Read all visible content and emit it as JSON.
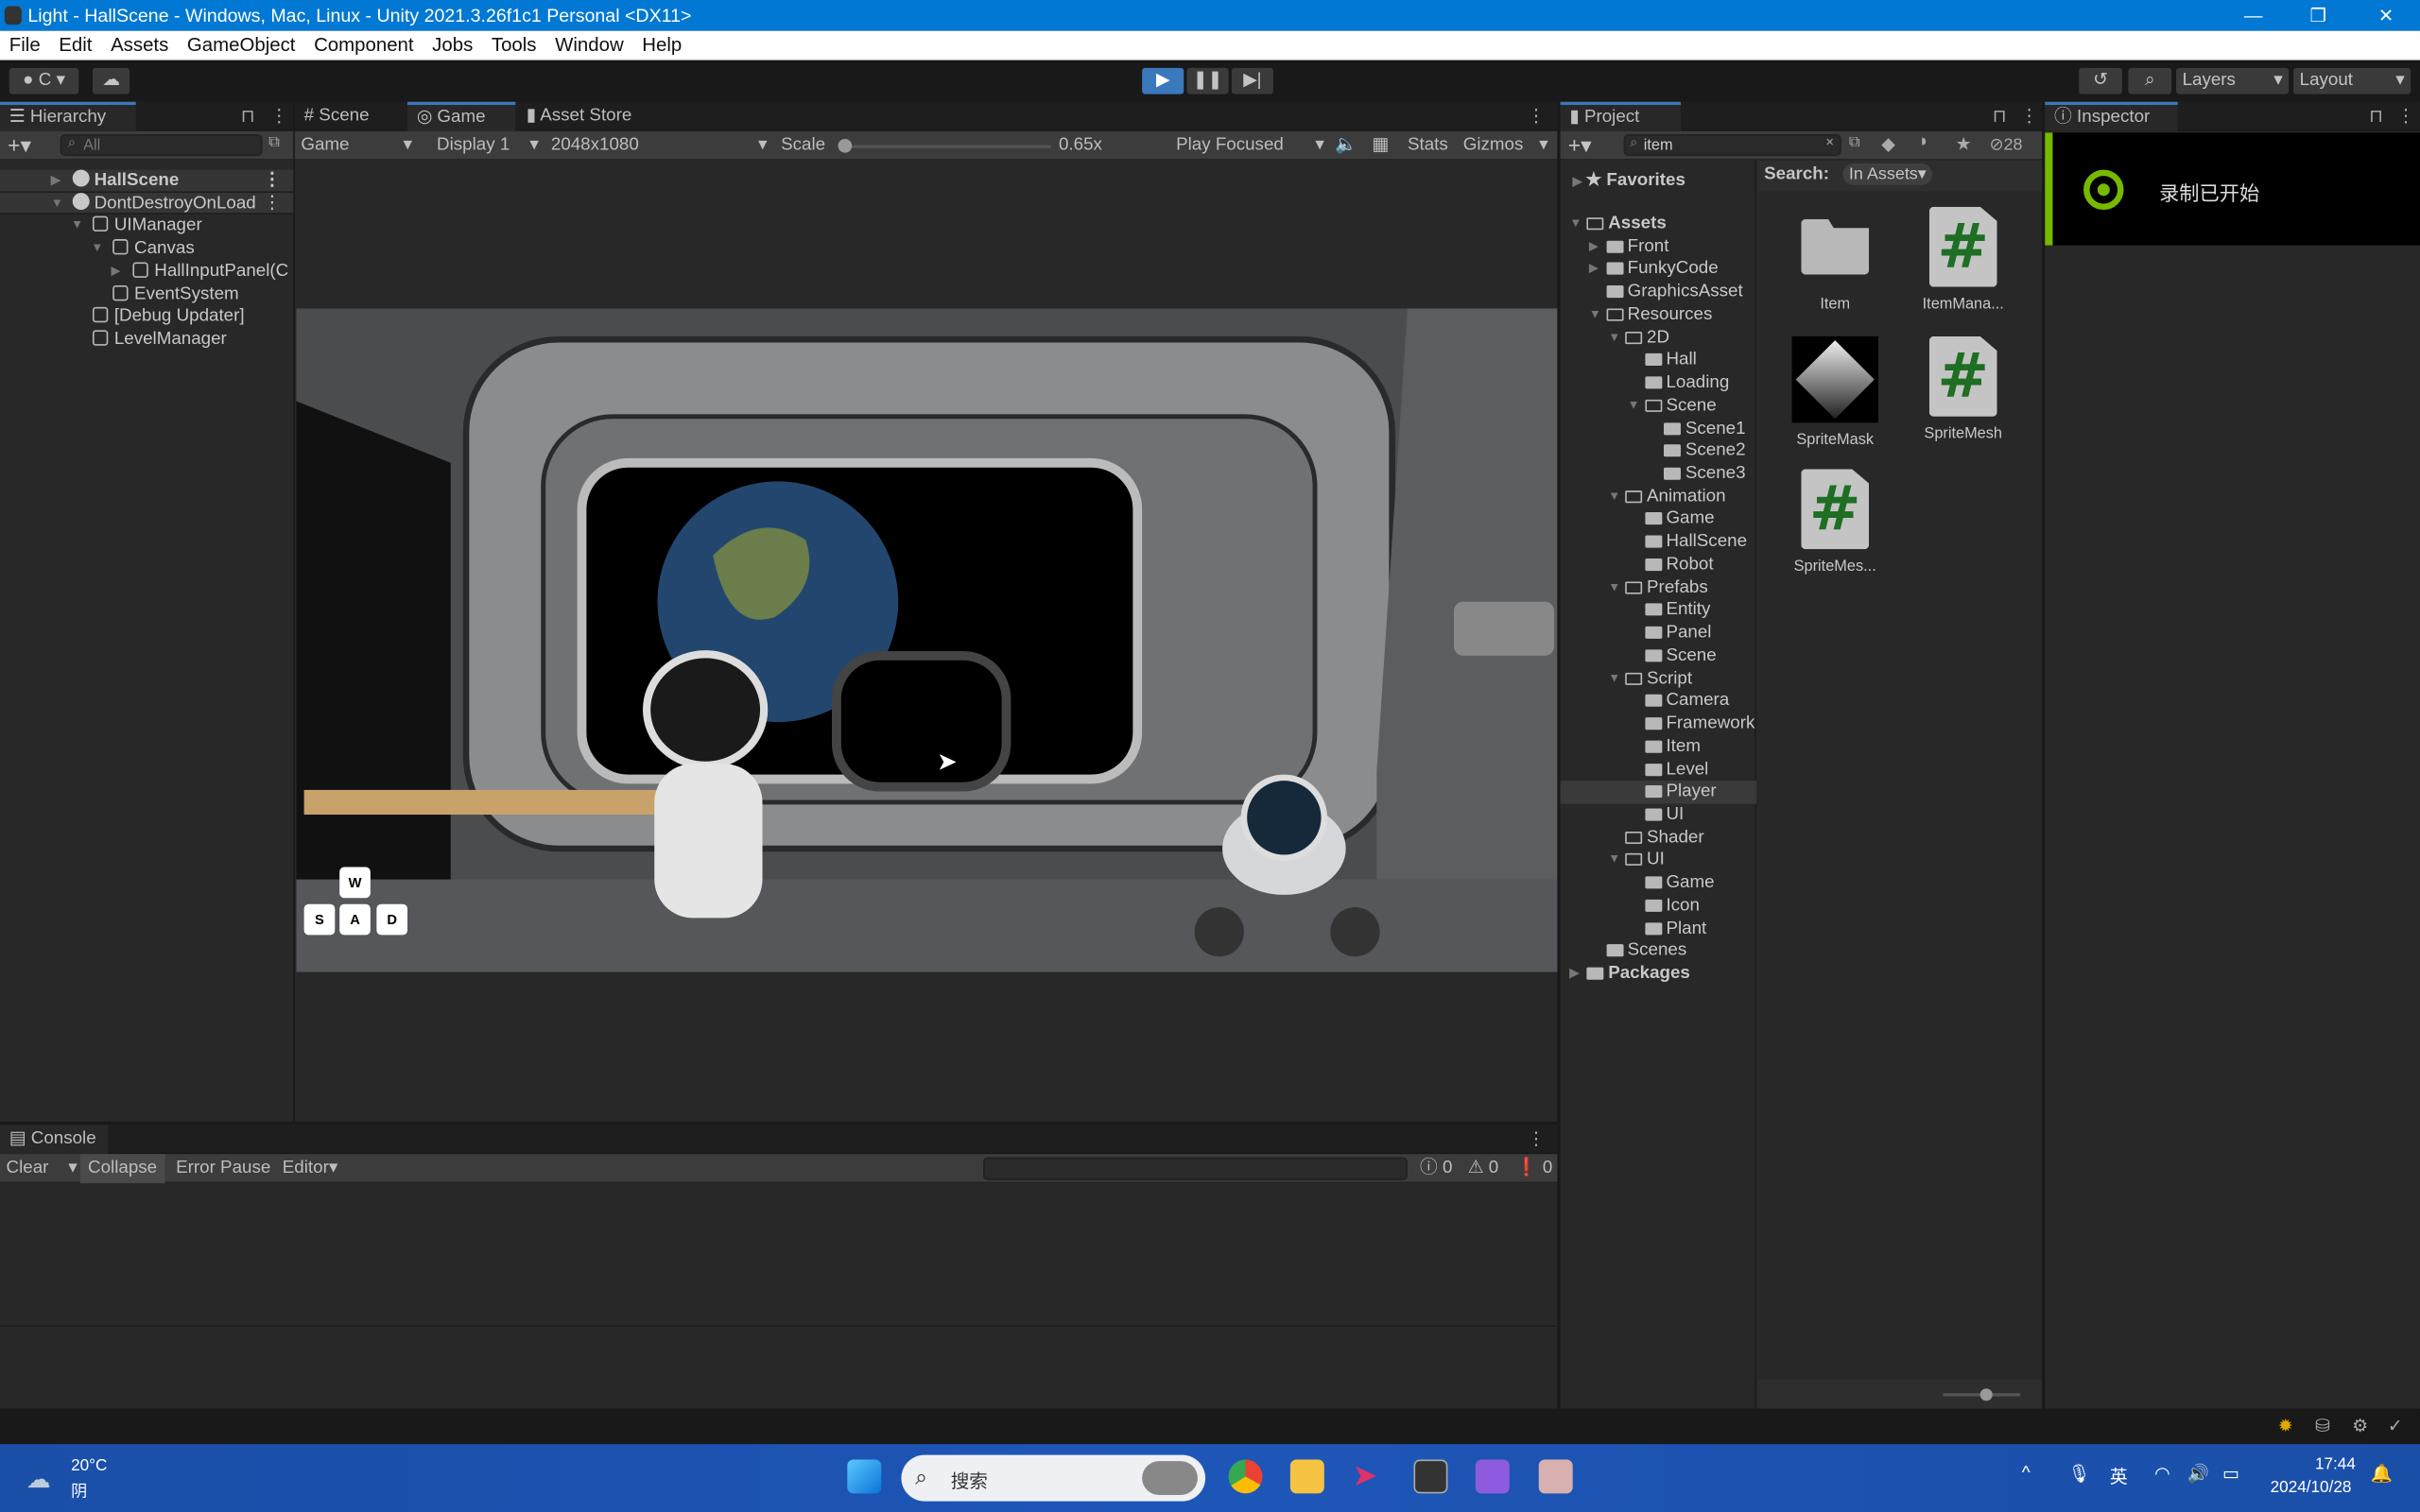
{
  "window": {
    "title": "Light - HallScene - Windows, Mac, Linux - Unity 2021.3.26f1c1 Personal <DX11>",
    "controls": [
      "—",
      "❐",
      "✕"
    ]
  },
  "menu": [
    "File",
    "Edit",
    "Assets",
    "GameObject",
    "Component",
    "Jobs",
    "Tools",
    "Window",
    "Help"
  ],
  "toolbar": {
    "account_label": "C",
    "layers_label": "Layers",
    "layout_label": "Layout",
    "accent": "#3a79bb"
  },
  "hierarchy": {
    "tab": "Hierarchy",
    "search_placeholder": "All",
    "items": [
      {
        "label": "HallScene",
        "level": 0,
        "type": "scene",
        "expand": "closed",
        "bold": true
      },
      {
        "label": "DontDestroyOnLoad",
        "level": 0,
        "type": "scene",
        "expand": "open"
      },
      {
        "label": "UIManager",
        "level": 1,
        "type": "object",
        "expand": "open"
      },
      {
        "label": "Canvas",
        "level": 2,
        "type": "object",
        "expand": "open"
      },
      {
        "label": "HallInputPanel(C",
        "level": 3,
        "type": "object",
        "expand": "closed"
      },
      {
        "label": "EventSystem",
        "level": 2,
        "type": "object"
      },
      {
        "label": "[Debug Updater]",
        "level": 1,
        "type": "object"
      },
      {
        "label": "LevelManager",
        "level": 1,
        "type": "object"
      }
    ]
  },
  "scene_tabs": [
    {
      "label": "Scene",
      "icon": "hash-icon"
    },
    {
      "label": "Game",
      "icon": "gamepad-icon",
      "active": true
    },
    {
      "label": "Asset Store",
      "icon": "bag-icon"
    }
  ],
  "game": {
    "mode": "Game",
    "display": "Display 1",
    "resolution": "2048x1080",
    "scale_label": "Scale",
    "scale_value": "0.65x",
    "play_mode": "Play Focused",
    "stats": "Stats",
    "gizmos": "Gizmos",
    "keys": [
      "W",
      "S",
      "A",
      "D"
    ]
  },
  "project": {
    "tab": "Project",
    "search_value": "item",
    "hidden_count": "28",
    "favorites": "Favorites",
    "search_label": "Search:",
    "search_scope": "In Assets",
    "tree": [
      {
        "label": "Assets",
        "level": 0,
        "expand": "open",
        "bold": true
      },
      {
        "label": "Front",
        "level": 1,
        "expand": "closed"
      },
      {
        "label": "FunkyCode",
        "level": 1,
        "expand": "closed"
      },
      {
        "label": "GraphicsAsset",
        "level": 1
      },
      {
        "label": "Resources",
        "level": 1,
        "expand": "open"
      },
      {
        "label": "2D",
        "level": 2,
        "expand": "open"
      },
      {
        "label": "Hall",
        "level": 3
      },
      {
        "label": "Loading",
        "level": 3
      },
      {
        "label": "Scene",
        "level": 3,
        "expand": "open"
      },
      {
        "label": "Scene1",
        "level": 4
      },
      {
        "label": "Scene2",
        "level": 4
      },
      {
        "label": "Scene3",
        "level": 4
      },
      {
        "label": "Animation",
        "level": 2,
        "expand": "open"
      },
      {
        "label": "Game",
        "level": 3
      },
      {
        "label": "HallScene",
        "level": 3
      },
      {
        "label": "Robot",
        "level": 3
      },
      {
        "label": "Prefabs",
        "level": 2,
        "expand": "open"
      },
      {
        "label": "Entity",
        "level": 3
      },
      {
        "label": "Panel",
        "level": 3
      },
      {
        "label": "Scene",
        "level": 3
      },
      {
        "label": "Script",
        "level": 2,
        "expand": "open"
      },
      {
        "label": "Camera",
        "level": 3
      },
      {
        "label": "Framework",
        "level": 3
      },
      {
        "label": "Item",
        "level": 3
      },
      {
        "label": "Level",
        "level": 3
      },
      {
        "label": "Player",
        "level": 3,
        "selected": true
      },
      {
        "label": "UI",
        "level": 3
      },
      {
        "label": "Shader",
        "level": 2,
        "empty": true
      },
      {
        "label": "UI",
        "level": 2,
        "expand": "open"
      },
      {
        "label": "Game",
        "level": 3
      },
      {
        "label": "Icon",
        "level": 3
      },
      {
        "label": "Plant",
        "level": 3
      },
      {
        "label": "Scenes",
        "level": 1
      },
      {
        "label": "Packages",
        "level": 0,
        "expand": "closed",
        "bold": true
      }
    ],
    "assets": [
      {
        "label": "Item",
        "kind": "folder"
      },
      {
        "label": "ItemMana...",
        "kind": "script"
      },
      {
        "label": "SpriteMask",
        "kind": "sprite"
      },
      {
        "label": "SpriteMesh",
        "kind": "script"
      },
      {
        "label": "SpriteMes...",
        "kind": "script"
      }
    ]
  },
  "inspector": {
    "tab": "Inspector",
    "notification": "录制已开始",
    "notification_accent": "#76b900"
  },
  "console": {
    "tab": "Console",
    "clear": "Clear",
    "collapse": "Collapse",
    "error_pause": "Error Pause",
    "editor": "Editor",
    "info_count": "0",
    "warn_count": "0",
    "error_count": "0"
  },
  "taskbar": {
    "temperature": "20°C",
    "weather": "阴",
    "search_placeholder": "搜索",
    "ime": "英",
    "time": "17:44",
    "date": "2024/10/28"
  }
}
